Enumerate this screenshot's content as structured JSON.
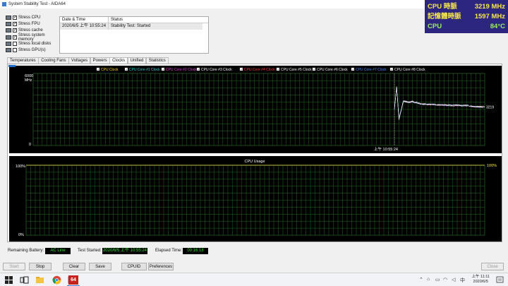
{
  "window": {
    "title": "System Stability Test - AIDA64"
  },
  "osd": {
    "rows": [
      {
        "label": "CPU 時脈",
        "value": "3219 MHz"
      },
      {
        "label": "記憶體時脈",
        "value": "1597 MHz"
      },
      {
        "label": "CPU",
        "value": "84°C"
      }
    ]
  },
  "stress": [
    {
      "label": "Stress CPU",
      "checked": true
    },
    {
      "label": "Stress FPU",
      "checked": true
    },
    {
      "label": "Stress cache",
      "checked": true
    },
    {
      "label": "Stress system memory",
      "checked": true
    },
    {
      "label": "Stress local disks",
      "checked": false
    },
    {
      "label": "Stress GPU(s)",
      "checked": false
    }
  ],
  "status_table": {
    "headers": [
      "Date & Time",
      "Status"
    ],
    "rows": [
      [
        "2020/6/5 上午 10:55:24",
        "Stability Test: Started"
      ]
    ]
  },
  "tabs": [
    "Temperatures",
    "Cooling Fans",
    "Voltages",
    "Powers",
    "Clocks",
    "Unified",
    "Statistics"
  ],
  "active_tab": "Clocks",
  "chart_data": [
    {
      "type": "line",
      "legend": [
        {
          "name": "CPU Clock",
          "color": "#ffd21f"
        },
        {
          "name": "CPU Core #1 Clock",
          "color": "#2fd3d0"
        },
        {
          "name": "CPU Core #2 Clock",
          "color": "#e040d8"
        },
        {
          "name": "CPU Core #3 Clock",
          "color": "#ffffff"
        },
        {
          "name": "CPU Core #4 Clock",
          "color": "#ff3b3b"
        },
        {
          "name": "CPU Core #5 Clock",
          "color": "#ffffff"
        },
        {
          "name": "CPU Core #6 Clock",
          "color": "#ffffff"
        },
        {
          "name": "CPU Core #7 Clock",
          "color": "#4a8cff"
        },
        {
          "name": "CPU Core #8 Clock",
          "color": "#ffffff"
        }
      ],
      "ylabel_top": "6000",
      "yunit": "MHz",
      "ylabel_bottom": "0",
      "ylim": [
        0,
        6000
      ],
      "xlabel_marker": "上午 10:55:24",
      "marker_fraction": 0.8,
      "value_label": "3219",
      "x": [
        0.8,
        0.805,
        0.81,
        0.82,
        0.83,
        0.84,
        0.85,
        0.86,
        0.88,
        0.9,
        0.92,
        0.94,
        0.96,
        0.98,
        1.0
      ],
      "y": [
        3000,
        4900,
        2200,
        3700,
        3600,
        3650,
        3550,
        3450,
        3420,
        3380,
        3350,
        3340,
        3330,
        3220,
        3219
      ]
    },
    {
      "type": "line",
      "title": "CPU Usage",
      "ylabel_top": "100%",
      "ylabel_bottom": "0%",
      "ylim": [
        0,
        100
      ],
      "value_label": "100%",
      "x": [
        0.0,
        1.0
      ],
      "y": [
        100,
        100
      ]
    }
  ],
  "status_bar": {
    "battery_label": "Remaining Battery:",
    "battery_value": "AC Line",
    "started_label": "Test Started:",
    "started_value": "2020/6/5 上午 10:55:24",
    "elapsed_label": "Elapsed Time:",
    "elapsed_value": "00:16:18"
  },
  "buttons": {
    "start": "Start",
    "stop": "Stop",
    "clear": "Clear",
    "save": "Save",
    "cpuid": "CPUID",
    "preferences": "Preferences",
    "close": "Close"
  },
  "taskbar": {
    "app_badge": "64",
    "time": "上午 11:11",
    "date": "2020/6/5"
  }
}
